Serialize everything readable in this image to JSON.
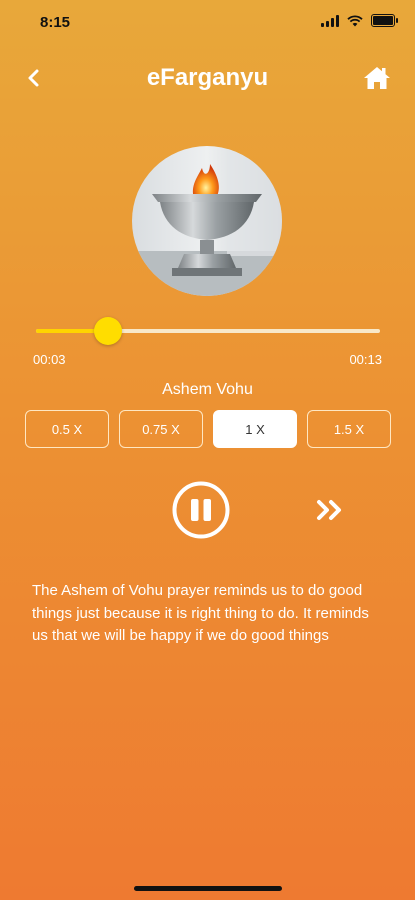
{
  "status_bar": {
    "time": "8:15",
    "icons": [
      "signal-icon",
      "wifi-icon",
      "battery-icon"
    ]
  },
  "header": {
    "title": "eFarganyu",
    "back_icon": "chevron-left-icon",
    "home_icon": "home-icon"
  },
  "player": {
    "elapsed": "00:03",
    "total": "00:13",
    "progress": 0.21,
    "track_title": "Ashem Vohu",
    "speeds": [
      "0.5 X",
      "0.75 X",
      "1 X",
      "1.5 X"
    ],
    "selected_speed": "1 X",
    "state": "playing",
    "controls": [
      "pause-icon",
      "fast-forward-icon"
    ]
  },
  "description": "The Ashem of Vohu prayer reminds us to do good things just because it is right thing to do. It reminds us that we will be happy if we do good things",
  "colors": {
    "accent": "#FFDD00",
    "bg_top": "#E8A83A",
    "bg_bottom": "#EE7A31"
  }
}
